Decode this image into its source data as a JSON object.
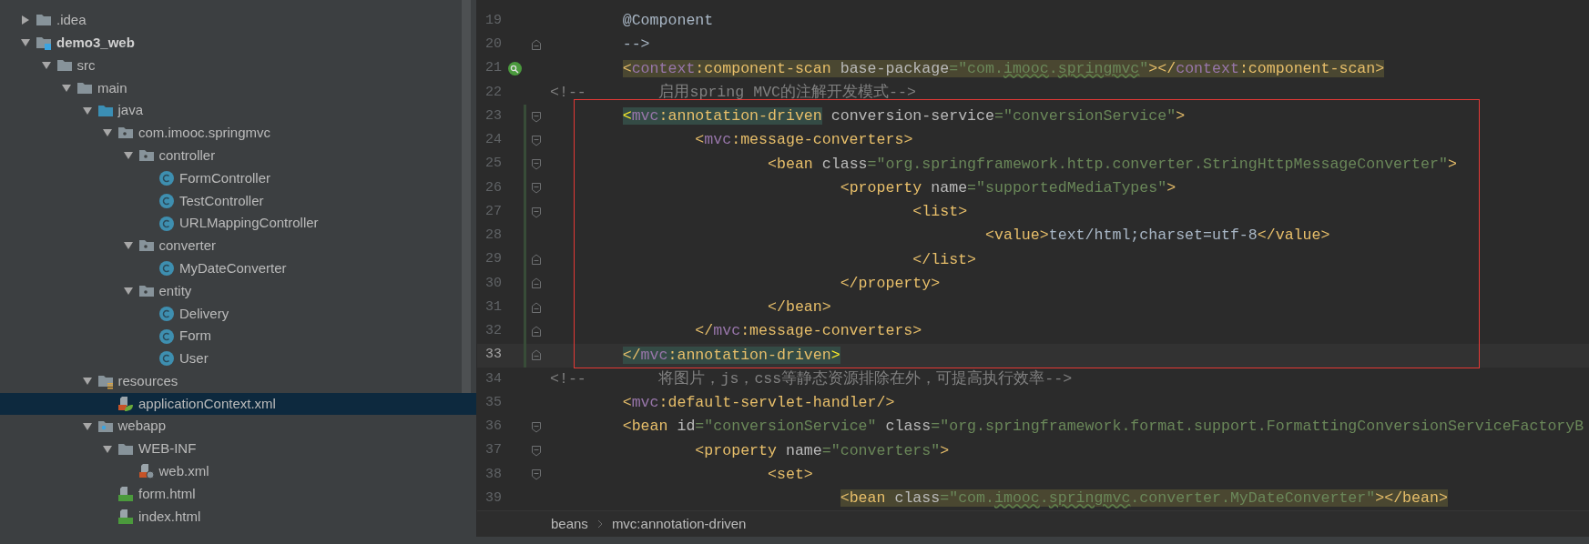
{
  "project_tree": [
    {
      "name": ".idea",
      "kind": "folder",
      "expanded": false,
      "selected": false
    },
    {
      "name": "demo3_web",
      "kind": "module",
      "expanded": true,
      "selected": false,
      "children": [
        {
          "name": "src",
          "kind": "folder",
          "expanded": true,
          "selected": false,
          "children": [
            {
              "name": "main",
              "kind": "folder",
              "expanded": true,
              "selected": false,
              "children": [
                {
                  "name": "java",
                  "kind": "source-folder",
                  "expanded": true,
                  "selected": false,
                  "children": [
                    {
                      "name": "com.imooc.springmvc",
                      "kind": "package",
                      "expanded": true,
                      "selected": false,
                      "children": [
                        {
                          "name": "controller",
                          "kind": "package",
                          "expanded": true,
                          "selected": false,
                          "children": [
                            {
                              "name": "FormController",
                              "kind": "class",
                              "selected": false
                            },
                            {
                              "name": "TestController",
                              "kind": "class",
                              "selected": false
                            },
                            {
                              "name": "URLMappingController",
                              "kind": "class",
                              "selected": false
                            }
                          ]
                        },
                        {
                          "name": "converter",
                          "kind": "package",
                          "expanded": true,
                          "selected": false,
                          "children": [
                            {
                              "name": "MyDateConverter",
                              "kind": "class",
                              "selected": false
                            }
                          ]
                        },
                        {
                          "name": "entity",
                          "kind": "package",
                          "expanded": true,
                          "selected": false,
                          "children": [
                            {
                              "name": "Delivery",
                              "kind": "class",
                              "selected": false
                            },
                            {
                              "name": "Form",
                              "kind": "class",
                              "selected": false
                            },
                            {
                              "name": "User",
                              "kind": "class",
                              "selected": false
                            }
                          ]
                        }
                      ]
                    }
                  ]
                },
                {
                  "name": "resources",
                  "kind": "resources-folder",
                  "expanded": true,
                  "selected": false,
                  "children": [
                    {
                      "name": "applicationContext.xml",
                      "kind": "spring-xml",
                      "selected": true
                    }
                  ]
                },
                {
                  "name": "webapp",
                  "kind": "web-folder",
                  "expanded": true,
                  "selected": false,
                  "children": [
                    {
                      "name": "WEB-INF",
                      "kind": "folder",
                      "expanded": true,
                      "selected": false,
                      "children": [
                        {
                          "name": "web.xml",
                          "kind": "web-xml",
                          "selected": false
                        }
                      ]
                    },
                    {
                      "name": "form.html",
                      "kind": "html",
                      "selected": false
                    },
                    {
                      "name": "index.html",
                      "kind": "html",
                      "selected": false
                    }
                  ]
                }
              ]
            }
          ]
        }
      ]
    }
  ],
  "editor": {
    "lines": [
      {
        "number": "19",
        "current": false,
        "changed": false,
        "marker": false,
        "segments": [
          {
            "kind": "none",
            "tokens": [
              {
                "kind": "plain",
                "text": "        @Component"
              }
            ]
          }
        ]
      },
      {
        "number": "20",
        "current": false,
        "changed": false,
        "marker": false,
        "fold": {
          "kind": "end"
        },
        "segments": [
          {
            "kind": "none",
            "tokens": [
              {
                "kind": "plain",
                "text": "        -->"
              }
            ]
          }
        ]
      },
      {
        "number": "21",
        "current": false,
        "changed": false,
        "marker": true,
        "segments": [
          {
            "kind": "injected",
            "tokens": [
              {
                "kind": "punct",
                "text": "        <"
              },
              {
                "kind": "ns",
                "text": "context"
              },
              {
                "kind": "tag",
                "text": ":component-scan"
              },
              {
                "kind": "attr",
                "text": " base-package"
              },
              {
                "kind": "str",
                "text": "=\"com."
              },
              {
                "kind": "str",
                "text": "imooc",
                "typo": true
              },
              {
                "kind": "str",
                "text": "."
              },
              {
                "kind": "str",
                "text": "springmvc",
                "typo": true
              },
              {
                "kind": "str",
                "text": "\""
              },
              {
                "kind": "punct",
                "text": "></"
              },
              {
                "kind": "ns",
                "text": "context"
              },
              {
                "kind": "tag",
                "text": ":component-scan>"
              }
            ]
          }
        ]
      },
      {
        "number": "22",
        "current": false,
        "changed": false,
        "marker": false,
        "segments": [
          {
            "kind": "none",
            "tokens": [
              {
                "kind": "comment",
                "text": "<!--        启用spring MVC的注解开发模式-->"
              }
            ]
          }
        ]
      },
      {
        "number": "23",
        "current": false,
        "changed": true,
        "marker": false,
        "fold": {
          "kind": "start"
        },
        "segments": [
          {
            "kind": "match",
            "tokens": [
              {
                "kind": "match",
                "text": "        <"
              },
              {
                "kind": "ns",
                "text": "mvc"
              },
              {
                "kind": "tag",
                "text": ":annotation-driven"
              }
            ]
          },
          {
            "kind": "none",
            "tokens": [
              {
                "kind": "attr",
                "text": " conversion-service"
              },
              {
                "kind": "str",
                "text": "=\"conversionService\""
              },
              {
                "kind": "punct",
                "text": ">"
              }
            ]
          }
        ]
      },
      {
        "number": "24",
        "current": false,
        "changed": true,
        "marker": false,
        "fold": {
          "kind": "start"
        },
        "segments": [
          {
            "kind": "none",
            "tokens": [
              {
                "kind": "punct",
                "text": "                <"
              },
              {
                "kind": "ns",
                "text": "mvc"
              },
              {
                "kind": "tag",
                "text": ":message-converters"
              },
              {
                "kind": "punct",
                "text": ">"
              }
            ]
          }
        ]
      },
      {
        "number": "25",
        "current": false,
        "changed": true,
        "marker": false,
        "fold": {
          "kind": "start"
        },
        "segments": [
          {
            "kind": "none",
            "tokens": [
              {
                "kind": "punct",
                "text": "                        <"
              },
              {
                "kind": "tag",
                "text": "bean"
              },
              {
                "kind": "attr",
                "text": " class"
              },
              {
                "kind": "str",
                "text": "=\"org.springframework.http.converter.StringHttpMessageConverter\""
              },
              {
                "kind": "punct",
                "text": ">"
              }
            ]
          }
        ]
      },
      {
        "number": "26",
        "current": false,
        "changed": true,
        "marker": false,
        "fold": {
          "kind": "start"
        },
        "segments": [
          {
            "kind": "none",
            "tokens": [
              {
                "kind": "punct",
                "text": "                                <"
              },
              {
                "kind": "tag",
                "text": "property"
              },
              {
                "kind": "attr",
                "text": " name"
              },
              {
                "kind": "str",
                "text": "=\"supportedMediaTypes\""
              },
              {
                "kind": "punct",
                "text": ">"
              }
            ]
          }
        ]
      },
      {
        "number": "27",
        "current": false,
        "changed": true,
        "marker": false,
        "fold": {
          "kind": "start"
        },
        "segments": [
          {
            "kind": "none",
            "tokens": [
              {
                "kind": "punct",
                "text": "                                        <"
              },
              {
                "kind": "tag",
                "text": "list"
              },
              {
                "kind": "punct",
                "text": ">"
              }
            ]
          }
        ]
      },
      {
        "number": "28",
        "current": false,
        "changed": true,
        "marker": false,
        "segments": [
          {
            "kind": "none",
            "tokens": [
              {
                "kind": "punct",
                "text": "                                                <"
              },
              {
                "kind": "tag",
                "text": "value"
              },
              {
                "kind": "punct",
                "text": ">"
              },
              {
                "kind": "text",
                "text": "text/html;charset=utf-8"
              },
              {
                "kind": "punct",
                "text": "</"
              },
              {
                "kind": "tag",
                "text": "value"
              },
              {
                "kind": "punct",
                "text": ">"
              }
            ]
          }
        ]
      },
      {
        "number": "29",
        "current": false,
        "changed": true,
        "marker": false,
        "fold": {
          "kind": "end"
        },
        "segments": [
          {
            "kind": "none",
            "tokens": [
              {
                "kind": "punct",
                "text": "                                        </"
              },
              {
                "kind": "tag",
                "text": "list"
              },
              {
                "kind": "punct",
                "text": ">"
              }
            ]
          }
        ]
      },
      {
        "number": "30",
        "current": false,
        "changed": true,
        "marker": false,
        "fold": {
          "kind": "end"
        },
        "segments": [
          {
            "kind": "none",
            "tokens": [
              {
                "kind": "punct",
                "text": "                                </"
              },
              {
                "kind": "tag",
                "text": "property"
              },
              {
                "kind": "punct",
                "text": ">"
              }
            ]
          }
        ]
      },
      {
        "number": "31",
        "current": false,
        "changed": true,
        "marker": false,
        "fold": {
          "kind": "end"
        },
        "segments": [
          {
            "kind": "none",
            "tokens": [
              {
                "kind": "punct",
                "text": "                        </"
              },
              {
                "kind": "tag",
                "text": "bean"
              },
              {
                "kind": "punct",
                "text": ">"
              }
            ]
          }
        ]
      },
      {
        "number": "32",
        "current": false,
        "changed": true,
        "marker": false,
        "fold": {
          "kind": "end"
        },
        "segments": [
          {
            "kind": "none",
            "tokens": [
              {
                "kind": "punct",
                "text": "                </"
              },
              {
                "kind": "ns",
                "text": "mvc"
              },
              {
                "kind": "tag",
                "text": ":message-converters"
              },
              {
                "kind": "punct",
                "text": ">"
              }
            ]
          }
        ]
      },
      {
        "number": "33",
        "current": true,
        "changed": true,
        "marker": false,
        "fold": {
          "kind": "end"
        },
        "segments": [
          {
            "kind": "match",
            "tokens": [
              {
                "kind": "punct",
                "text": "        </"
              },
              {
                "kind": "ns",
                "text": "mvc"
              },
              {
                "kind": "tag",
                "text": ":annotation-driven"
              },
              {
                "kind": "match",
                "text": ">"
              }
            ]
          }
        ]
      },
      {
        "number": "34",
        "current": false,
        "changed": false,
        "marker": false,
        "segments": [
          {
            "kind": "none",
            "tokens": [
              {
                "kind": "comment",
                "text": "<!--        将图片，js，css等静态资源排除在外，可提高执行效率-->"
              }
            ]
          }
        ]
      },
      {
        "number": "35",
        "current": false,
        "changed": false,
        "marker": false,
        "segments": [
          {
            "kind": "none",
            "tokens": [
              {
                "kind": "punct",
                "text": "        <"
              },
              {
                "kind": "ns",
                "text": "mvc"
              },
              {
                "kind": "tag",
                "text": ":default-servlet-handler"
              },
              {
                "kind": "punct",
                "text": "/>"
              }
            ]
          }
        ]
      },
      {
        "number": "36",
        "current": false,
        "changed": false,
        "marker": false,
        "fold": {
          "kind": "start"
        },
        "segments": [
          {
            "kind": "none",
            "tokens": [
              {
                "kind": "punct",
                "text": "        <"
              },
              {
                "kind": "tag",
                "text": "bean"
              },
              {
                "kind": "attr",
                "text": " id"
              },
              {
                "kind": "str",
                "text": "=\"conversionService\""
              },
              {
                "kind": "attr",
                "text": " class"
              },
              {
                "kind": "str",
                "text": "=\"org.springframework.format.support.FormattingConversionServiceFactoryB"
              }
            ]
          }
        ]
      },
      {
        "number": "37",
        "current": false,
        "changed": false,
        "marker": false,
        "fold": {
          "kind": "start"
        },
        "segments": [
          {
            "kind": "none",
            "tokens": [
              {
                "kind": "punct",
                "text": "                <"
              },
              {
                "kind": "tag",
                "text": "property"
              },
              {
                "kind": "attr",
                "text": " name"
              },
              {
                "kind": "str",
                "text": "=\"converters\""
              },
              {
                "kind": "punct",
                "text": ">"
              }
            ]
          }
        ]
      },
      {
        "number": "38",
        "current": false,
        "changed": false,
        "marker": false,
        "fold": {
          "kind": "start"
        },
        "segments": [
          {
            "kind": "none",
            "tokens": [
              {
                "kind": "punct",
                "text": "                        <"
              },
              {
                "kind": "tag",
                "text": "set"
              },
              {
                "kind": "punct",
                "text": ">"
              }
            ]
          }
        ]
      },
      {
        "number": "39",
        "current": false,
        "changed": false,
        "marker": false,
        "segments": [
          {
            "kind": "injected",
            "tokens": [
              {
                "kind": "punct",
                "text": "                                <"
              },
              {
                "kind": "tag",
                "text": "bean"
              },
              {
                "kind": "attr",
                "text": " class"
              },
              {
                "kind": "str",
                "text": "=\"com."
              },
              {
                "kind": "str",
                "text": "imooc",
                "typo": true
              },
              {
                "kind": "str",
                "text": "."
              },
              {
                "kind": "str",
                "text": "springmvc",
                "typo": true
              },
              {
                "kind": "str",
                "text": ".converter.MyDateConverter\""
              },
              {
                "kind": "punct",
                "text": "></"
              },
              {
                "kind": "tag",
                "text": "bean"
              },
              {
                "kind": "punct",
                "text": ">"
              }
            ]
          }
        ]
      }
    ]
  },
  "breadcrumbs": [
    "beans",
    "mvc:annotation-driven"
  ]
}
